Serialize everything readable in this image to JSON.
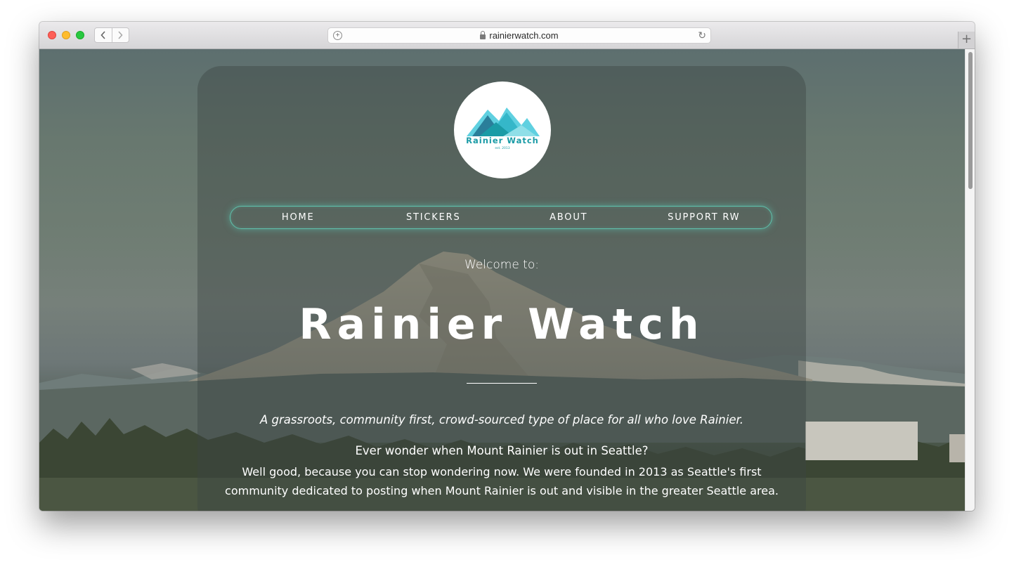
{
  "browser": {
    "url": "rainierwatch.com",
    "back_icon": "chevron-left-icon",
    "forward_icon": "chevron-right-icon",
    "reload_icon": "reload-icon",
    "new_tab_label": "+"
  },
  "site": {
    "logo": {
      "name": "Rainier Watch",
      "established": "est. 2013",
      "colors": [
        "#1a9ba6",
        "#35b7c9",
        "#5fd0e0",
        "#2a7e9a"
      ]
    },
    "nav": [
      {
        "label": "HOME"
      },
      {
        "label": "STICKERS"
      },
      {
        "label": "ABOUT"
      },
      {
        "label": "SUPPORT RW"
      }
    ],
    "welcome": "Welcome to:",
    "title": "Rainier Watch",
    "tagline": "A grassroots, community first, crowd-sourced type of place for all who love Rainier.",
    "question": "Ever wonder when Mount Rainier is out in Seattle?",
    "description": "Well good, because you can stop wondering now. We were founded in 2013 as Seattle's first community dedicated to posting when Mount Rainier is out and visible in the greater Seattle area.",
    "accent_color": "#5fc2ad"
  }
}
